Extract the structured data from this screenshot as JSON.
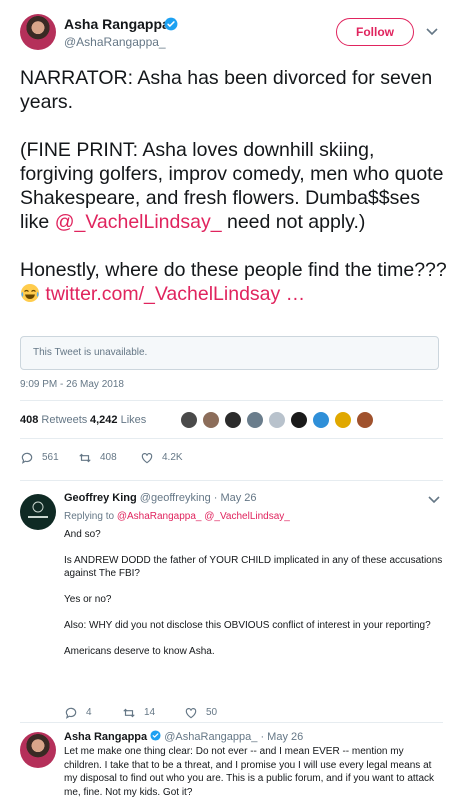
{
  "tweet": {
    "author_name": "Asha Rangappa",
    "author_handle": "@AshaRangappa_",
    "follow_label": "Follow",
    "paragraph1": "NARRATOR: Asha has been divorced for seven years.",
    "paragraph2_prefix": "(FINE PRINT: Asha loves downhill skiing, forgiving golfers, improv comedy, men who quote Shakespeare, and fresh flowers. Dumba$$ses like ",
    "paragraph2_mention": "@_VachelLindsay_",
    "paragraph2_suffix": "  need not apply.)",
    "paragraph3_prefix": "Honestly, where do these people find the time??? ",
    "paragraph3_link": "twitter.com/_VachelLindsay …",
    "quoted_unavailable": "This Tweet is unavailable.",
    "timestamp": "9:09 PM - 26 May 2018",
    "retweets_count": "408",
    "retweets_label": "Retweets",
    "likes_count": "4,242",
    "likes_label": "Likes",
    "reply_count": "561",
    "retweet_action_count": "408",
    "like_action_count": "4.2K"
  },
  "replies": [
    {
      "author_name": "Geoffrey King",
      "meta": "@geoffreyking · May 26",
      "replying_label": "Replying to",
      "replying_to_1": "@AshaRangappa_",
      "replying_to_2": "@_VachelLindsay_",
      "lines": [
        "And so?",
        "Is ANDREW DODD the father of YOUR CHILD implicated in any of these accusations against The FBI?",
        "Yes or no?",
        "Also: WHY did you not disclose this OBVIOUS conflict of interest in your reporting?",
        "Americans deserve to know Asha."
      ],
      "reply_count": "4",
      "retweet_count": "14",
      "like_count": "50"
    },
    {
      "author_name": "Asha Rangappa",
      "meta": "@AshaRangappa_ · May 26",
      "text": "Let me make one thing clear: Do not ever -- and I mean EVER -- mention my children. I take that to be a threat, and I promise you I will use every legal means at my disposal to find out who you are. This is a public forum, and if you want to attack me, fine. Not my kids. Got it?"
    }
  ],
  "colors": {
    "accent": "#e0245e",
    "verified": "#1da1f2",
    "secondary_text": "#657786",
    "border": "#e6ecf0"
  },
  "icons": {
    "verified": "verified-badge-icon",
    "caret": "chevron-down-icon",
    "reply": "reply-icon",
    "retweet": "retweet-icon",
    "like": "heart-icon",
    "emoji": "face-with-tears-of-joy-icon"
  }
}
